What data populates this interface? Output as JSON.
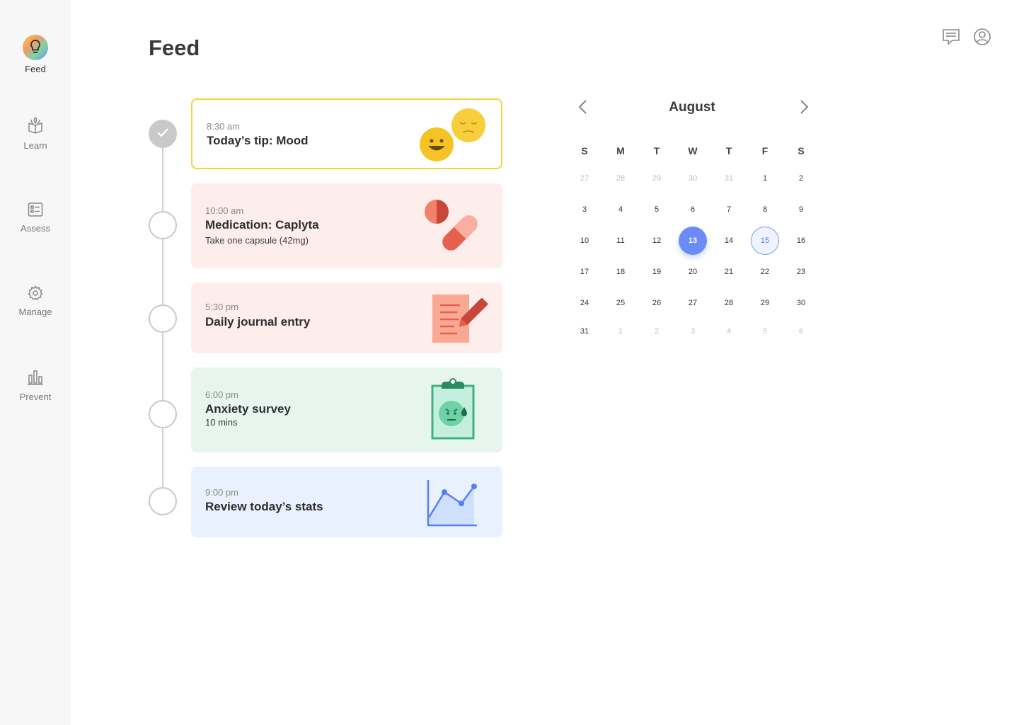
{
  "sidebar": {
    "items": [
      {
        "label": "Feed",
        "icon": "lightbulb-icon",
        "active": true
      },
      {
        "label": "Learn",
        "icon": "book-icon"
      },
      {
        "label": "Assess",
        "icon": "checklist-icon"
      },
      {
        "label": "Manage",
        "icon": "gear-icon"
      },
      {
        "label": "Prevent",
        "icon": "bar-chart-icon"
      }
    ]
  },
  "header": {
    "title": "Feed",
    "icons": [
      "chat-icon",
      "profile-icon"
    ]
  },
  "feed": {
    "cards": [
      {
        "time": "8:30 am",
        "title": "Today’s tip: Mood",
        "subtitle": "",
        "done": true,
        "icon": "mood-emoji-icon"
      },
      {
        "time": "10:00 am",
        "title": "Medication: Caplyta",
        "subtitle": "Take one capsule (42mg)",
        "done": false,
        "icon": "pill-capsule-icon"
      },
      {
        "time": "5:30 pm",
        "title": "Daily journal entry",
        "subtitle": "",
        "done": false,
        "icon": "journal-pencil-icon"
      },
      {
        "time": "6:00 pm",
        "title": "Anxiety survey",
        "subtitle": "10 mins",
        "done": false,
        "icon": "clipboard-survey-icon"
      },
      {
        "time": "9:00 pm",
        "title": "Review today’s stats",
        "subtitle": "",
        "done": false,
        "icon": "line-chart-icon"
      }
    ]
  },
  "calendar": {
    "month": "August",
    "weekdays": [
      "S",
      "M",
      "T",
      "W",
      "T",
      "F",
      "S"
    ],
    "weeks": [
      [
        "27",
        "28",
        "29",
        "30",
        "31",
        "1",
        "2"
      ],
      [
        "3",
        "4",
        "5",
        "6",
        "7",
        "8",
        "9"
      ],
      [
        "10",
        "11",
        "12",
        "13",
        "14",
        "15",
        "16"
      ],
      [
        "17",
        "18",
        "19",
        "20",
        "21",
        "22",
        "23"
      ],
      [
        "24",
        "25",
        "26",
        "27",
        "28",
        "29",
        "30"
      ],
      [
        "31",
        "1",
        "2",
        "3",
        "4",
        "5",
        "6"
      ]
    ],
    "selected_day": "13",
    "highlighted_day": "15"
  },
  "colors": {
    "accent": "#6b8cf7",
    "tip_border": "#f5d33a",
    "medication_bg": "#fdeeec",
    "journal_bg": "#fdeeec",
    "survey_bg": "#e6f6ef",
    "stats_bg": "#eaf1fe"
  }
}
